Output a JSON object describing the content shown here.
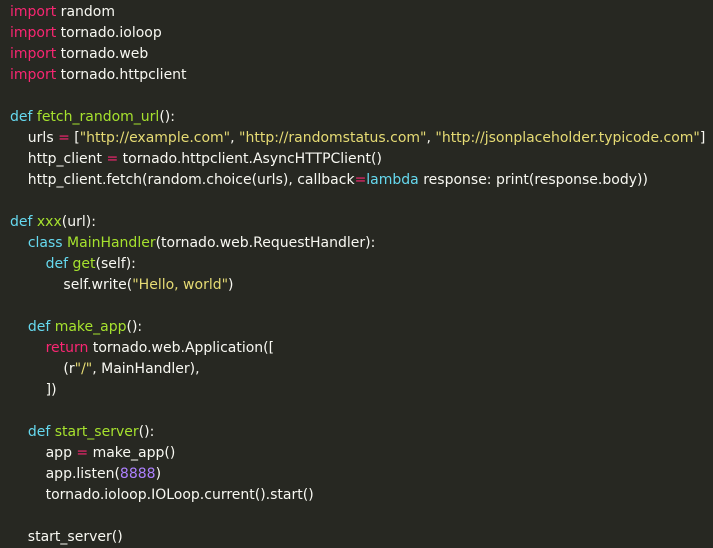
{
  "colors": {
    "background": "#272822",
    "keyword": "#f92672",
    "definition": "#66d9ef",
    "function": "#a6e22e",
    "string": "#e6db74",
    "number": "#ae81ff",
    "text": "#f8f8f2"
  },
  "lines": [
    [
      [
        "kw",
        "import"
      ],
      [
        "plain",
        " random"
      ]
    ],
    [
      [
        "kw",
        "import"
      ],
      [
        "plain",
        " tornado.ioloop"
      ]
    ],
    [
      [
        "kw",
        "import"
      ],
      [
        "plain",
        " tornado.web"
      ]
    ],
    [
      [
        "kw",
        "import"
      ],
      [
        "plain",
        " tornado.httpclient"
      ]
    ],
    [],
    [
      [
        "def",
        "def"
      ],
      [
        "plain",
        " "
      ],
      [
        "fn",
        "fetch_random_url"
      ],
      [
        "plain",
        "():"
      ]
    ],
    [
      [
        "plain",
        "    urls "
      ],
      [
        "op",
        "="
      ],
      [
        "plain",
        " ["
      ],
      [
        "str",
        "\"http://example.com\""
      ],
      [
        "plain",
        ", "
      ],
      [
        "str",
        "\"http://randomstatus.com\""
      ],
      [
        "plain",
        ", "
      ],
      [
        "str",
        "\"http://jsonplaceholder.typicode.com\""
      ],
      [
        "plain",
        "]"
      ]
    ],
    [
      [
        "plain",
        "    http_client "
      ],
      [
        "op",
        "="
      ],
      [
        "plain",
        " tornado.httpclient.AsyncHTTPClient()"
      ]
    ],
    [
      [
        "plain",
        "    http_client.fetch(random.choice(urls), callback"
      ],
      [
        "op",
        "="
      ],
      [
        "def",
        "lambda"
      ],
      [
        "plain",
        " response: print(response.body))"
      ]
    ],
    [],
    [
      [
        "def",
        "def"
      ],
      [
        "plain",
        " "
      ],
      [
        "fn",
        "xxx"
      ],
      [
        "plain",
        "(url):"
      ]
    ],
    [
      [
        "plain",
        "    "
      ],
      [
        "def",
        "class"
      ],
      [
        "plain",
        " "
      ],
      [
        "fn",
        "MainHandler"
      ],
      [
        "plain",
        "(tornado.web.RequestHandler):"
      ]
    ],
    [
      [
        "plain",
        "        "
      ],
      [
        "def",
        "def"
      ],
      [
        "plain",
        " "
      ],
      [
        "fn",
        "get"
      ],
      [
        "plain",
        "(self):"
      ]
    ],
    [
      [
        "plain",
        "            self.write("
      ],
      [
        "str",
        "\"Hello, world\""
      ],
      [
        "plain",
        ")"
      ]
    ],
    [],
    [
      [
        "plain",
        "    "
      ],
      [
        "def",
        "def"
      ],
      [
        "plain",
        " "
      ],
      [
        "fn",
        "make_app"
      ],
      [
        "plain",
        "():"
      ]
    ],
    [
      [
        "plain",
        "        "
      ],
      [
        "kw",
        "return"
      ],
      [
        "plain",
        " tornado.web.Application(["
      ]
    ],
    [
      [
        "plain",
        "            (r"
      ],
      [
        "str",
        "\"/\""
      ],
      [
        "plain",
        ", MainHandler),"
      ]
    ],
    [
      [
        "plain",
        "        ])"
      ]
    ],
    [],
    [
      [
        "plain",
        "    "
      ],
      [
        "def",
        "def"
      ],
      [
        "plain",
        " "
      ],
      [
        "fn",
        "start_server"
      ],
      [
        "plain",
        "():"
      ]
    ],
    [
      [
        "plain",
        "        app "
      ],
      [
        "op",
        "="
      ],
      [
        "plain",
        " make_app()"
      ]
    ],
    [
      [
        "plain",
        "        app.listen("
      ],
      [
        "num",
        "8888"
      ],
      [
        "plain",
        ")"
      ]
    ],
    [
      [
        "plain",
        "        tornado.ioloop.IOLoop.current().start()"
      ]
    ],
    [],
    [
      [
        "plain",
        "    start_server()"
      ]
    ]
  ]
}
